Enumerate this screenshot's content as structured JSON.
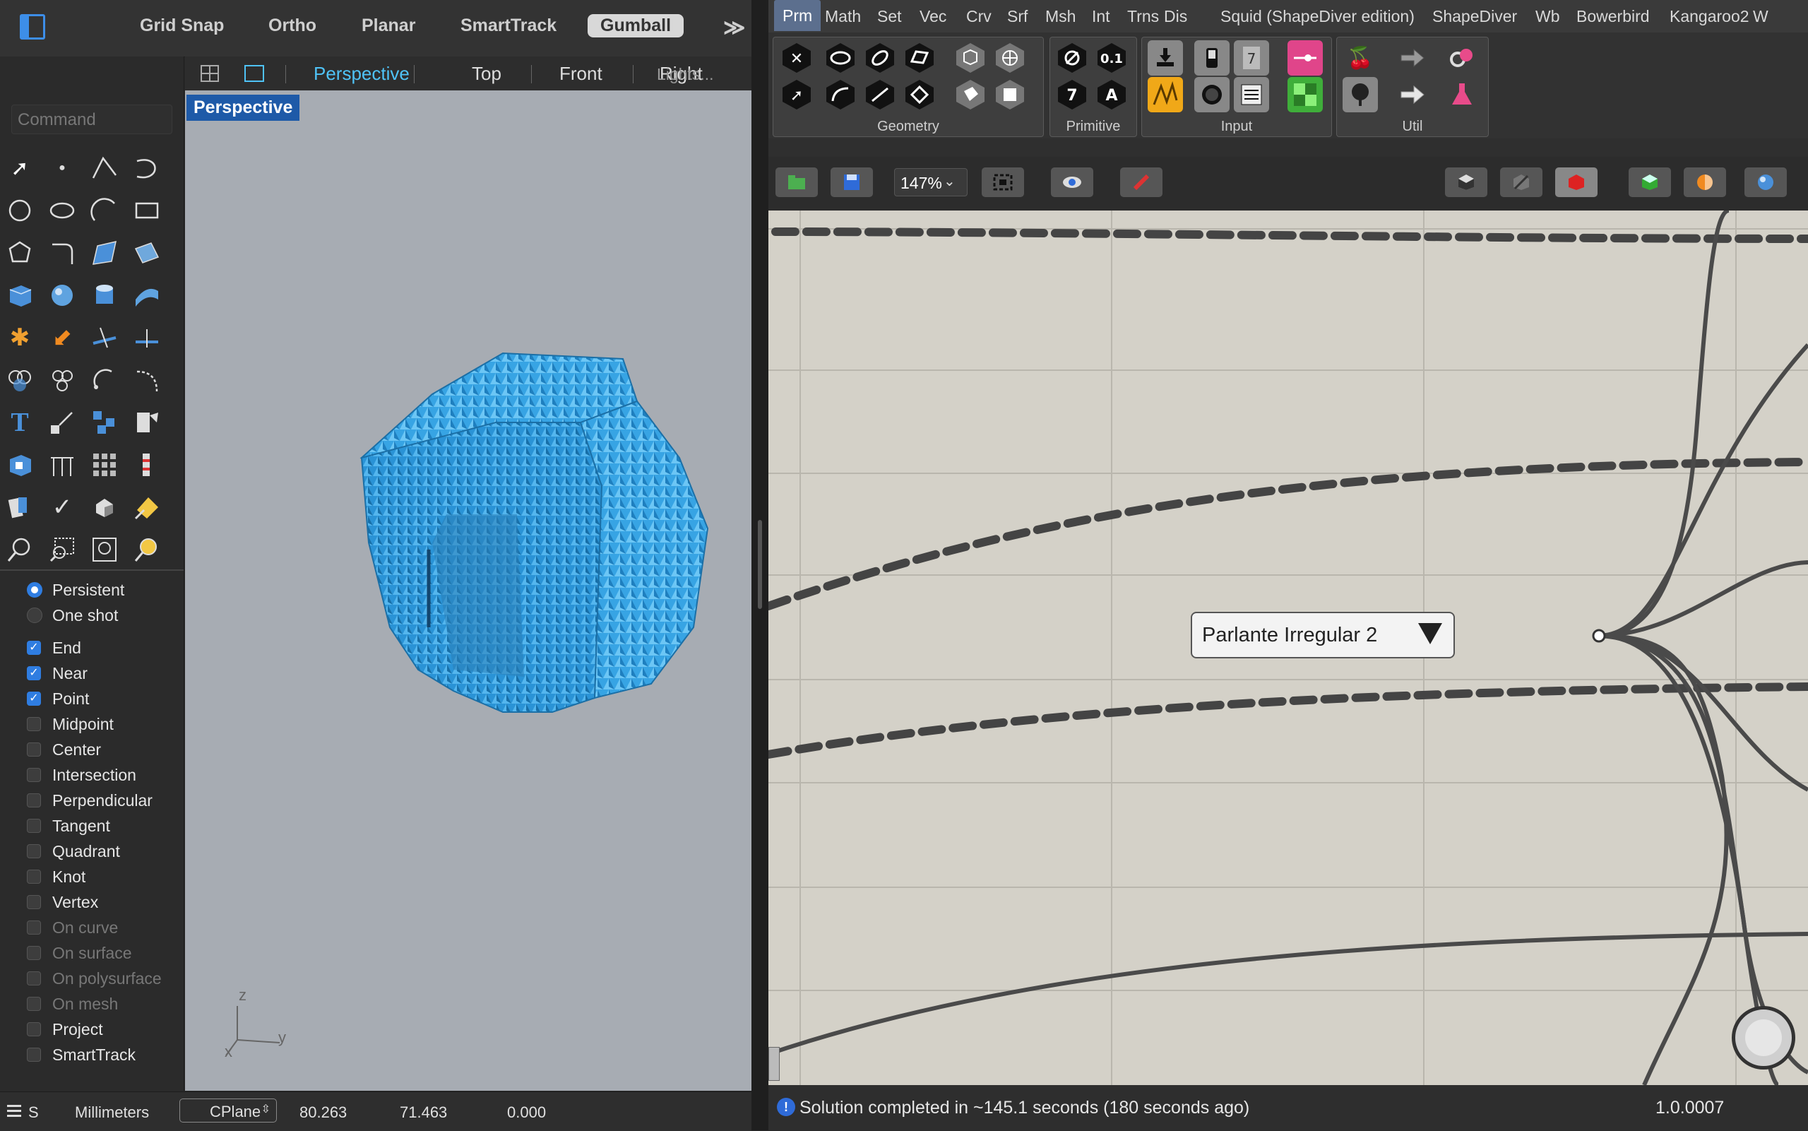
{
  "rhino": {
    "toggles": [
      "Grid Snap",
      "Ortho",
      "Planar",
      "SmartTrack",
      "Gumball"
    ],
    "active_toggle": "Gumball",
    "more_glyph": "≫",
    "viewport_tabs": [
      "Perspective",
      "Top",
      "Front",
      "Right"
    ],
    "active_viewport_tab": "Perspective",
    "lights_text": "Lights...",
    "command_placeholder": "Command",
    "viewport_label": "Perspective",
    "axis": {
      "z": "z",
      "y": "y",
      "x": "x"
    },
    "osnap_mode": [
      {
        "label": "Persistent",
        "selected": true
      },
      {
        "label": "One shot",
        "selected": false
      }
    ],
    "osnaps": [
      {
        "label": "End",
        "checked": true,
        "enabled": true
      },
      {
        "label": "Near",
        "checked": true,
        "enabled": true
      },
      {
        "label": "Point",
        "checked": true,
        "enabled": true
      },
      {
        "label": "Midpoint",
        "checked": false,
        "enabled": true
      },
      {
        "label": "Center",
        "checked": false,
        "enabled": true
      },
      {
        "label": "Intersection",
        "checked": false,
        "enabled": true
      },
      {
        "label": "Perpendicular",
        "checked": false,
        "enabled": true
      },
      {
        "label": "Tangent",
        "checked": false,
        "enabled": true
      },
      {
        "label": "Quadrant",
        "checked": false,
        "enabled": true
      },
      {
        "label": "Knot",
        "checked": false,
        "enabled": true
      },
      {
        "label": "Vertex",
        "checked": false,
        "enabled": true
      },
      {
        "label": "On curve",
        "checked": false,
        "enabled": false
      },
      {
        "label": "On surface",
        "checked": false,
        "enabled": false
      },
      {
        "label": "On polysurface",
        "checked": false,
        "enabled": false
      },
      {
        "label": "On mesh",
        "checked": false,
        "enabled": false
      },
      {
        "label": "Project",
        "checked": false,
        "enabled": true
      },
      {
        "label": "SmartTrack",
        "checked": false,
        "enabled": true
      }
    ],
    "status": {
      "s_label": "S",
      "units": "Millimeters",
      "cplane": "CPlane",
      "x": "80.263",
      "y": "71.463",
      "z": "0.000"
    },
    "model_color": "#3aa7e6"
  },
  "grasshopper": {
    "menu_tabs": [
      "Prm",
      "Math",
      "Set",
      "Vec",
      "Crv",
      "Srf",
      "Msh",
      "Int",
      "Trns",
      "Dis",
      "Squid (ShapeDiver edition)",
      "ShapeDiver",
      "Wb",
      "Bowerbird",
      "Kangaroo2",
      "W"
    ],
    "active_tab": "Prm",
    "panels": [
      {
        "label": "Geometry"
      },
      {
        "label": "Primitive"
      },
      {
        "label": "Input"
      },
      {
        "label": "Util"
      }
    ],
    "primitive_labels": {
      "number": "0.1",
      "integer": "7",
      "text": "A"
    },
    "zoom": "147%",
    "canvas_bg": "#d4d1c8",
    "component_label": "Parlante Irregular 2",
    "status_message": "Solution completed in ~145.1 seconds (180 seconds ago)",
    "version": "1.0.0007"
  }
}
